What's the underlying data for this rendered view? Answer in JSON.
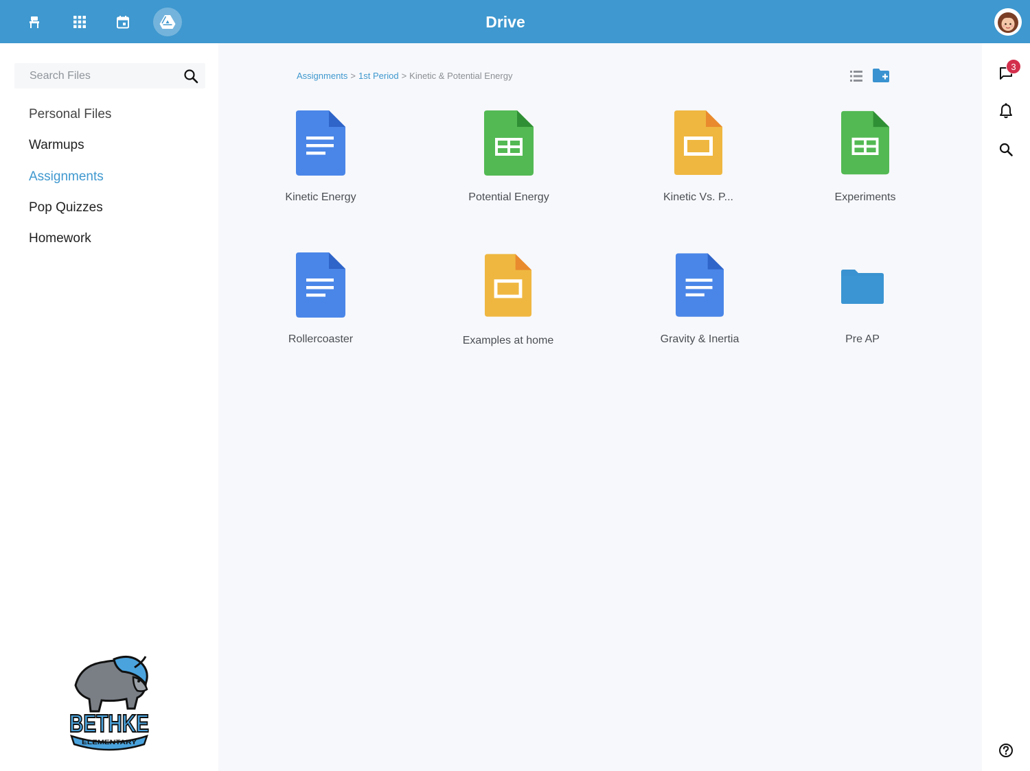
{
  "header": {
    "title": "Drive",
    "nav_icons": [
      "classroom-desk-icon",
      "apps-grid-icon",
      "calendar-icon",
      "drive-icon"
    ],
    "active_nav": "drive-icon"
  },
  "sidebar": {
    "search": {
      "placeholder": "Search Files",
      "value": ""
    },
    "items": [
      {
        "label": "Personal Files",
        "active": false
      },
      {
        "label": "Warmups",
        "active": false
      },
      {
        "label": "Assignments",
        "active": true
      },
      {
        "label": "Pop Quizzes",
        "active": false
      },
      {
        "label": "Homework",
        "active": false
      }
    ],
    "logo": {
      "main": "BETHKE",
      "sub": "ELEMENTARY"
    }
  },
  "breadcrumb": {
    "items": [
      "Assignments",
      "1st Period",
      "Kinetic & Potential Energy"
    ],
    "separator": ">"
  },
  "files": [
    {
      "name": "Kinetic Energy",
      "type": "doc"
    },
    {
      "name": "Potential Energy",
      "type": "sheet"
    },
    {
      "name": "Kinetic Vs. P...",
      "type": "slides"
    },
    {
      "name": "Experiments",
      "type": "sheet"
    },
    {
      "name": "Rollercoaster",
      "type": "doc"
    },
    {
      "name": "Examples at home",
      "type": "slides"
    },
    {
      "name": "Gravity & Inertia",
      "type": "doc"
    },
    {
      "name": "Pre AP",
      "type": "folder"
    }
  ],
  "right_rail": {
    "messages_badge": "3",
    "icons": [
      "chat-icon",
      "bell-icon",
      "search-icon",
      "help-icon"
    ]
  },
  "colors": {
    "accent": "#3f98cf",
    "doc": "#4a86e8",
    "sheet": "#53b953",
    "slides": "#efb740",
    "folder": "#3a93d0",
    "badge": "#d32f4c"
  }
}
